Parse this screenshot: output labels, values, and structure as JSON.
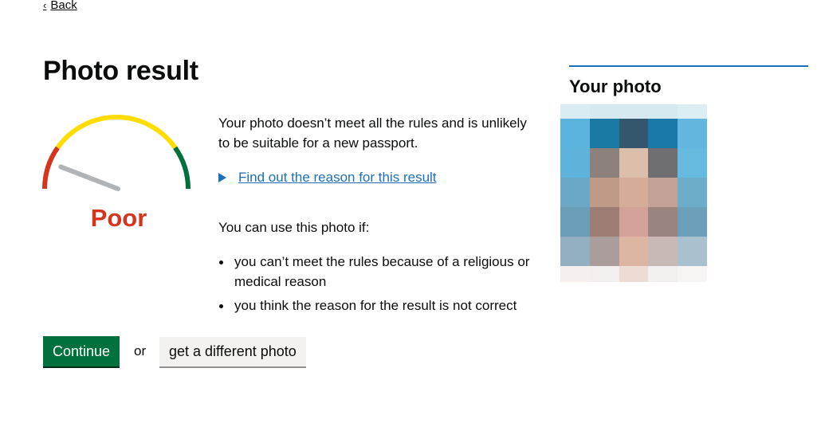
{
  "nav": {
    "back_label": "Back"
  },
  "page": {
    "title": "Photo result"
  },
  "gauge": {
    "label": "Poor",
    "level": 0.12,
    "colors": {
      "low": "#d4351c",
      "mid": "#ffdd00",
      "high": "#00703c",
      "needle": "#b1b4b6",
      "label": "#d4351c"
    }
  },
  "result": {
    "message": "Your photo doesn’t meet all the rules and is unlikely to be suitable for a new passport.",
    "details_summary": "Find out the reason for this result",
    "use_intro": "You can use this photo if:",
    "reasons": [
      "you can’t meet the rules because of a religious or medical reason",
      "you think the reason for the result is not correct"
    ]
  },
  "actions": {
    "continue_label": "Continue",
    "or_text": "or",
    "different_photo_label": "get a different photo"
  },
  "aside": {
    "heading": "Your photo",
    "pixels": [
      [
        "#d9ecf3",
        "#d6e9f1",
        "#d6e9f1",
        "#d6e9f1",
        "#dceef4"
      ],
      [
        "#5ab4dd",
        "#1a7aa4",
        "#34576d",
        "#1a79a8",
        "#62b6e0"
      ],
      [
        "#5db3db",
        "#8c817d",
        "#dcbfab",
        "#6f6f73",
        "#66b9df"
      ],
      [
        "#6ba8c7",
        "#bf9a86",
        "#d5ac98",
        "#c4a196",
        "#6cadc9"
      ],
      [
        "#6a9db8",
        "#9e7e74",
        "#d3a19a",
        "#9a8480",
        "#6c9fba"
      ],
      [
        "#92b0c2",
        "#aa9d9b",
        "#dcb5a3",
        "#c9b9b6",
        "#a9c0ce"
      ],
      [
        "#f5f0ee",
        "#f3efee",
        "#ecdcd4",
        "#f3efee",
        "#f7f5f4"
      ]
    ]
  }
}
